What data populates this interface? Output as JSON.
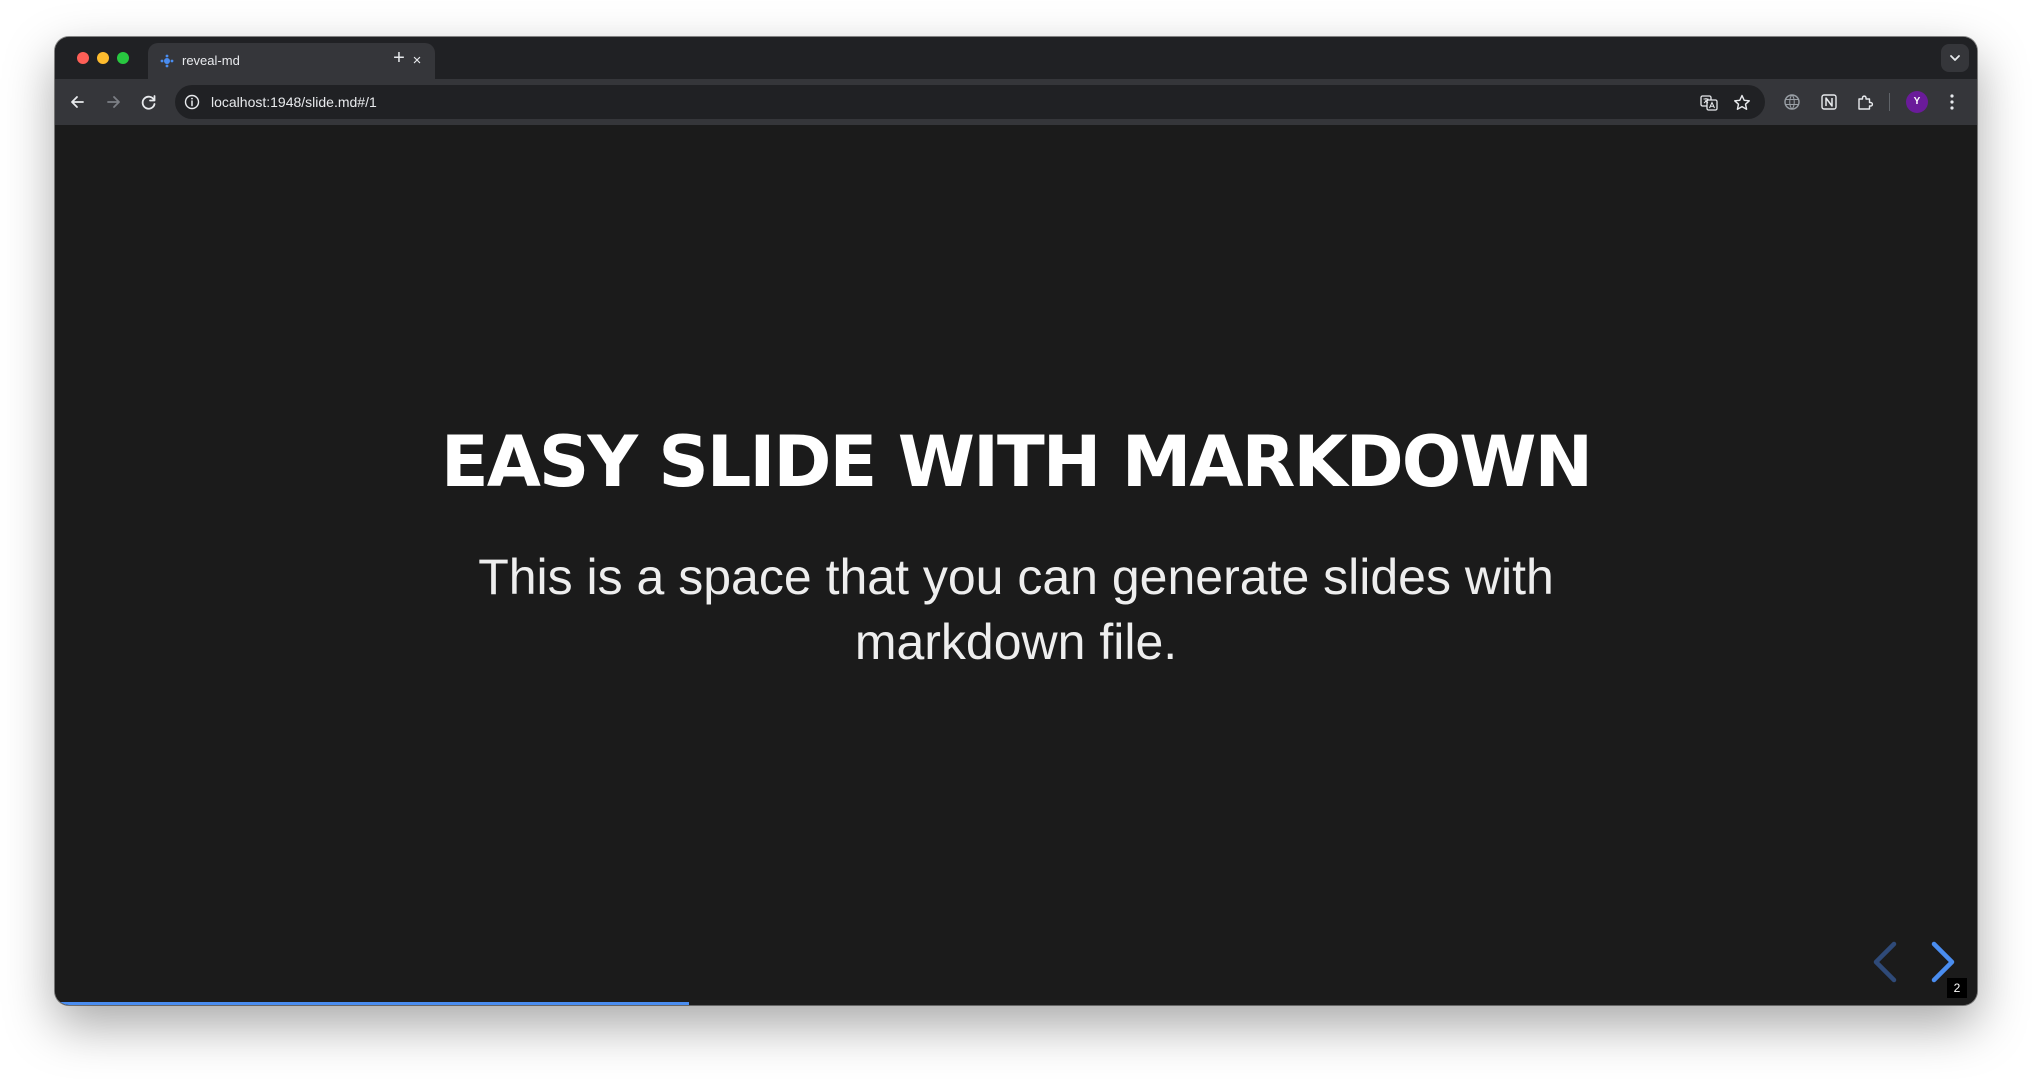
{
  "browser": {
    "tab": {
      "title": "reveal-md",
      "close_glyph": "×",
      "favicon": "reveal-logo-icon"
    },
    "new_tab_glyph": "+",
    "address": {
      "url": "localhost:1948/slide.md#/1"
    },
    "profile_initial": "Y",
    "colors": {
      "tab_strip": "#202124",
      "toolbar": "#35363a",
      "avatar": "#6a1b9a"
    }
  },
  "slide": {
    "title": "EASY SLIDE WITH MARKDOWN",
    "subtitle": "This is a space that you can generate slides with markdown file.",
    "slide_number": "2",
    "progress": 0.33,
    "colors": {
      "background": "#1b1b1b",
      "text": "#ffffff",
      "accent": "#4a8df0"
    }
  }
}
